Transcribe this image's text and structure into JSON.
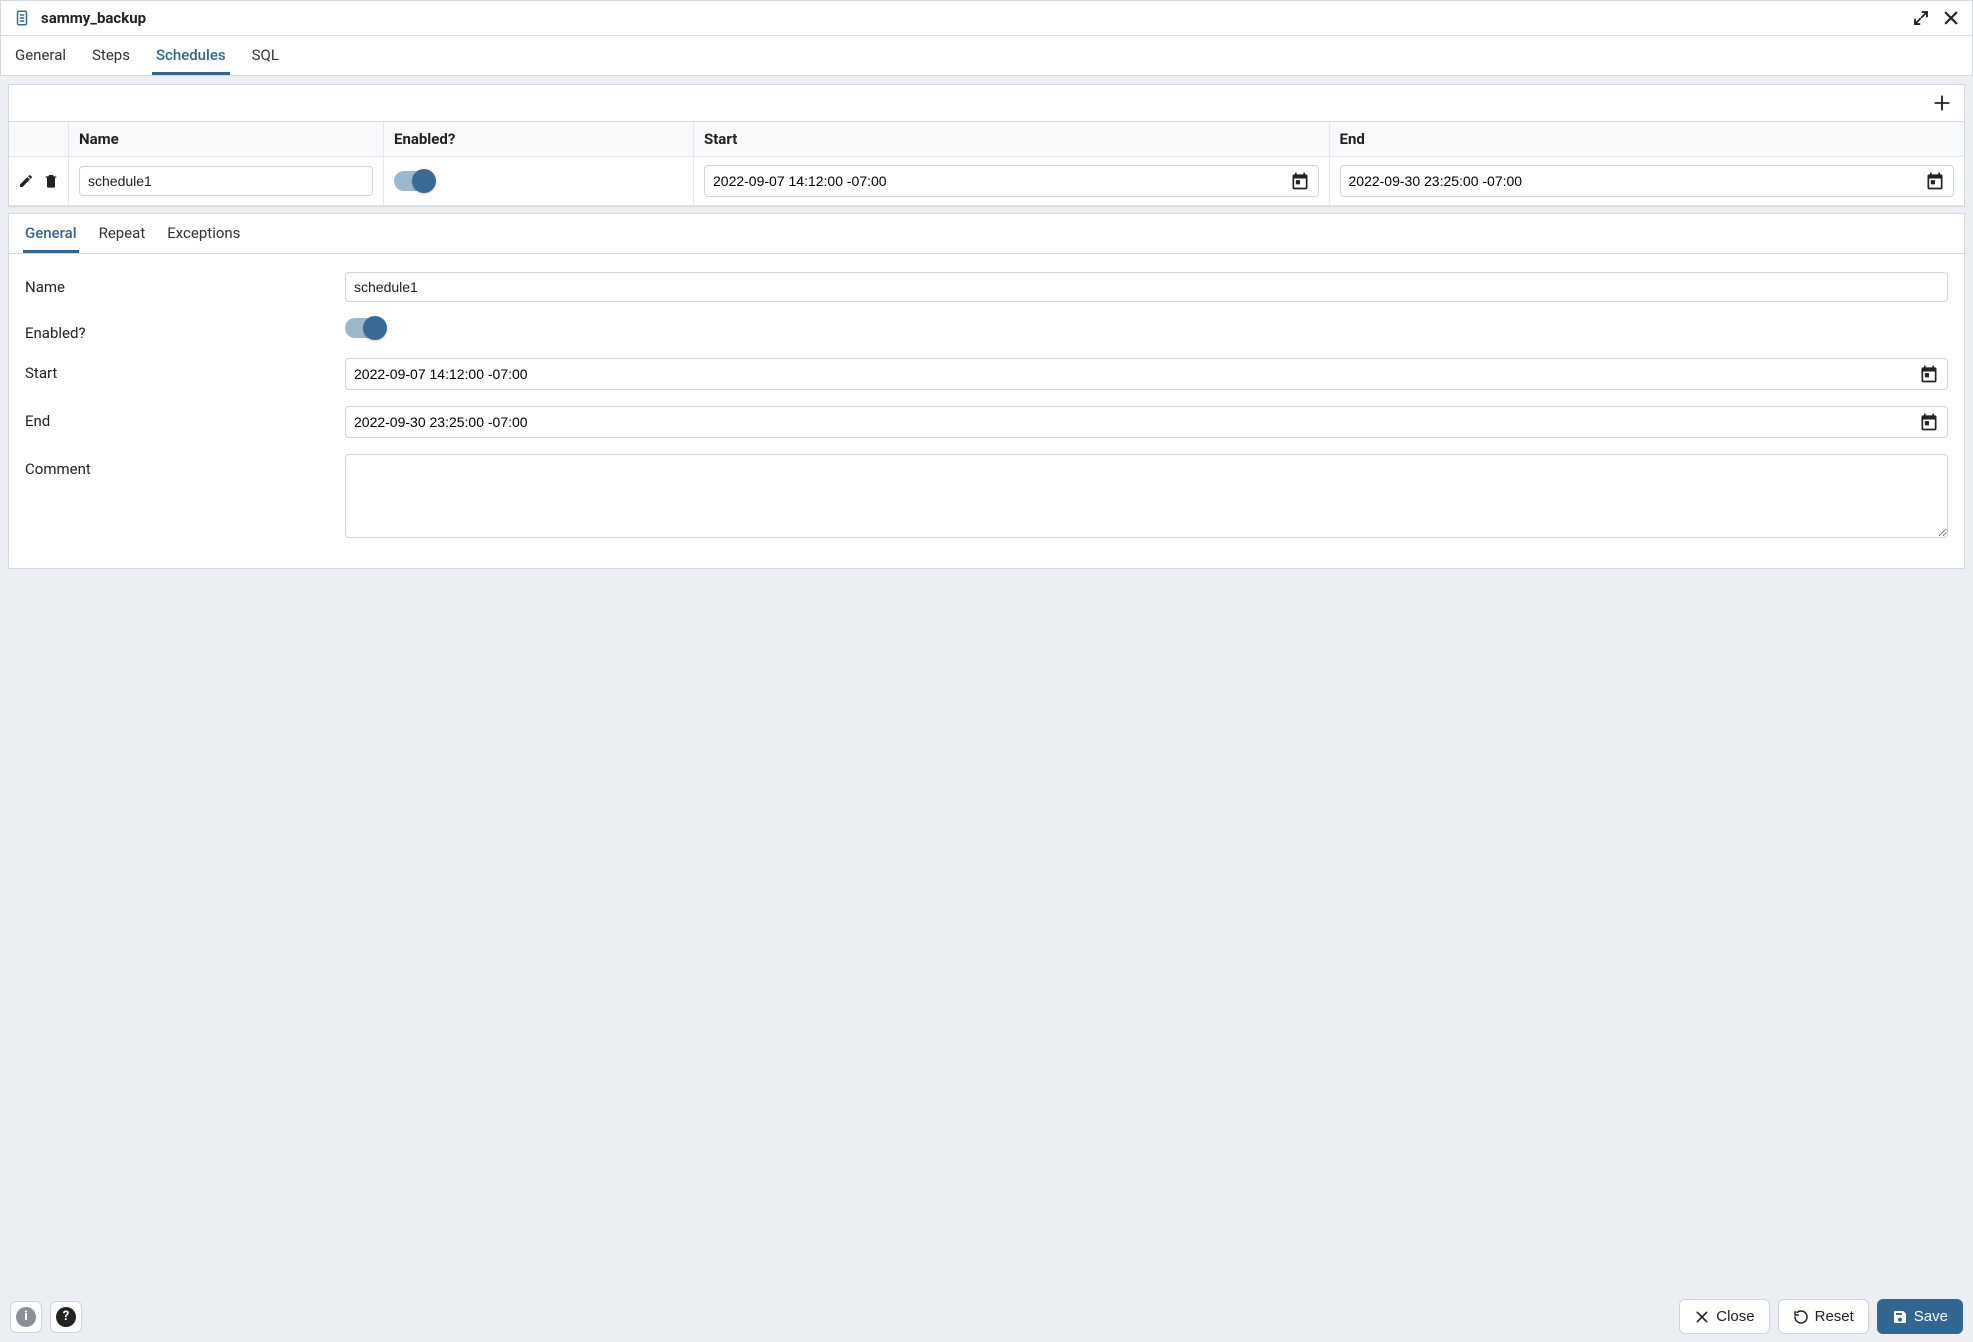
{
  "window": {
    "title": "sammy_backup"
  },
  "top_tabs": {
    "general": "General",
    "steps": "Steps",
    "schedules": "Schedules",
    "sql": "SQL",
    "active": "schedules"
  },
  "grid": {
    "headers": {
      "name": "Name",
      "enabled": "Enabled?",
      "start": "Start",
      "end": "End"
    },
    "row": {
      "name": "schedule1",
      "enabled": true,
      "start": "2022-09-07 14:12:00 -07:00",
      "end": "2022-09-30 23:25:00 -07:00"
    }
  },
  "detail_tabs": {
    "general": "General",
    "repeat": "Repeat",
    "exceptions": "Exceptions",
    "active": "general"
  },
  "form": {
    "labels": {
      "name": "Name",
      "enabled": "Enabled?",
      "start": "Start",
      "end": "End",
      "comment": "Comment"
    },
    "values": {
      "name": "schedule1",
      "enabled": true,
      "start": "2022-09-07 14:12:00 -07:00",
      "end": "2022-09-30 23:25:00 -07:00",
      "comment": ""
    }
  },
  "footer": {
    "close": "Close",
    "reset": "Reset",
    "save": "Save"
  }
}
